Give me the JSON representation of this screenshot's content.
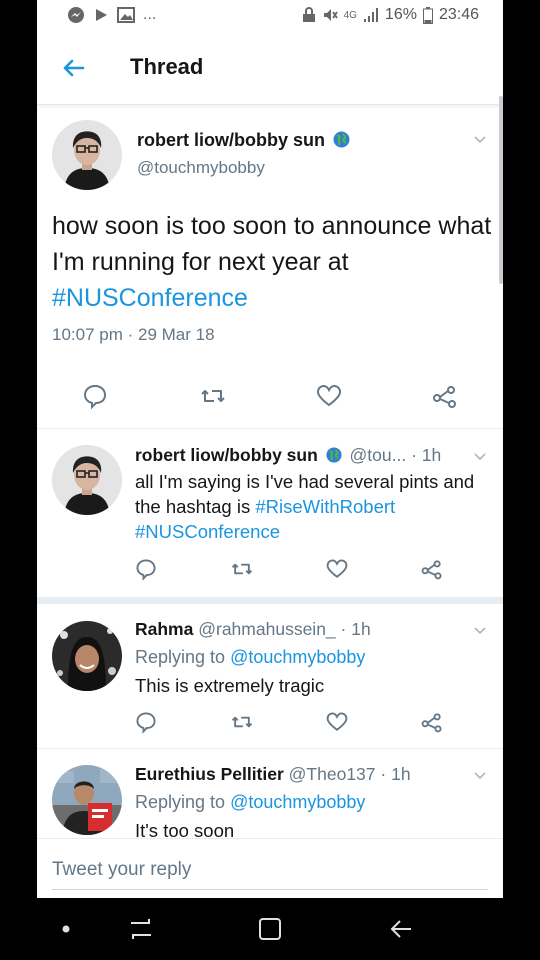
{
  "status_bar": {
    "battery": "16%",
    "time": "23:46",
    "network": "4G",
    "more": "..."
  },
  "header": {
    "title": "Thread"
  },
  "main_tweet": {
    "name": "robert liow/bobby sun",
    "handle": "@touchmybobby",
    "text_plain": "how soon is too soon to announce what I'm running for next year at",
    "hashtag": "#NUSConference",
    "timestamp": "10:07 pm · 29 Mar 18"
  },
  "replies": [
    {
      "name": "robert liow/bobby sun",
      "handle": "@tou...",
      "time": "· 1h",
      "text_plain": "all I'm saying is I've had several pints and the hashtag is",
      "hashtag1": "#RiseWithRobert",
      "hashtag2": "#NUSConference"
    },
    {
      "name": "Rahma",
      "handle": "@rahmahussein_",
      "time": "· 1h",
      "replying_label": "Replying to",
      "replying_handle": "@touchmybobby",
      "text": "This is extremely tragic"
    },
    {
      "name": "Eurethius Pellitier",
      "handle": "@Theo137",
      "time": "· 1h",
      "replying_label": "Replying to",
      "replying_handle": "@touchmybobby",
      "text": "It's too soon"
    }
  ],
  "reply_bar": {
    "placeholder": "Tweet your reply"
  },
  "colors": {
    "link": "#1b95e0",
    "muted": "#657786",
    "text": "#14171a",
    "divider": "#e6ecf0"
  },
  "icons": [
    "comment-icon",
    "retweet-icon",
    "like-icon",
    "share-icon",
    "back-arrow-icon",
    "chevron-down-icon",
    "globe-icon"
  ]
}
